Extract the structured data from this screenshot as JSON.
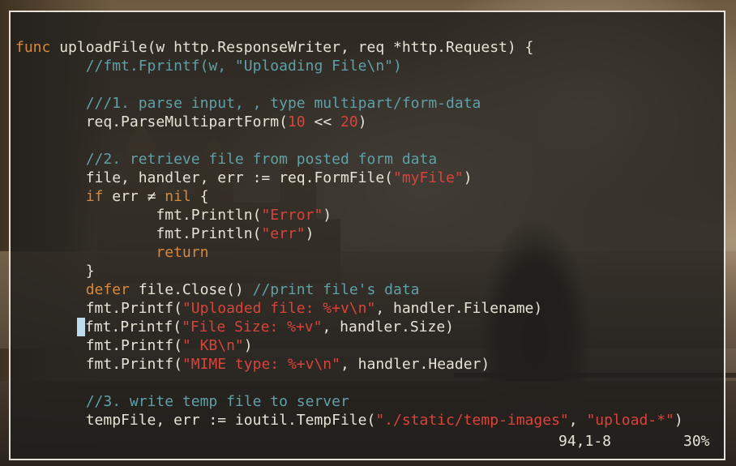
{
  "editor": {
    "lines": [
      [
        {
          "t": "func",
          "c": "kw"
        },
        {
          "t": " uploadFile(w http.ResponseWriter, req *http.Request) {",
          "c": ""
        }
      ],
      [
        {
          "t": "        ",
          "c": ""
        },
        {
          "t": "//fmt.Fprintf(w, \"Uploading File\\n\")",
          "c": "cm"
        }
      ],
      [],
      [
        {
          "t": "        ",
          "c": ""
        },
        {
          "t": "///1. parse input, , type multipart/form-data",
          "c": "cm"
        }
      ],
      [
        {
          "t": "        req.ParseMultipartForm(",
          "c": ""
        },
        {
          "t": "10",
          "c": "nm"
        },
        {
          "t": " << ",
          "c": ""
        },
        {
          "t": "20",
          "c": "nm"
        },
        {
          "t": ")",
          "c": ""
        }
      ],
      [],
      [
        {
          "t": "        ",
          "c": ""
        },
        {
          "t": "//2. retrieve file from posted form data",
          "c": "cm"
        }
      ],
      [
        {
          "t": "        file, handler, err := req.FormFile(",
          "c": ""
        },
        {
          "t": "\"myFile\"",
          "c": "st"
        },
        {
          "t": ")",
          "c": ""
        }
      ],
      [
        {
          "t": "        ",
          "c": ""
        },
        {
          "t": "if",
          "c": "kw"
        },
        {
          "t": " err ≠ ",
          "c": ""
        },
        {
          "t": "nil",
          "c": "kw"
        },
        {
          "t": " {",
          "c": ""
        }
      ],
      [
        {
          "t": "                fmt.Println(",
          "c": ""
        },
        {
          "t": "\"Error\"",
          "c": "st"
        },
        {
          "t": ")",
          "c": ""
        }
      ],
      [
        {
          "t": "                fmt.Println(",
          "c": ""
        },
        {
          "t": "\"err\"",
          "c": "st"
        },
        {
          "t": ")",
          "c": ""
        }
      ],
      [
        {
          "t": "                ",
          "c": ""
        },
        {
          "t": "return",
          "c": "kw"
        }
      ],
      [
        {
          "t": "        }",
          "c": ""
        }
      ],
      [
        {
          "t": "        ",
          "c": ""
        },
        {
          "t": "defer",
          "c": "kw"
        },
        {
          "t": " file.Close() ",
          "c": ""
        },
        {
          "t": "//print file's data",
          "c": "cm"
        }
      ],
      [
        {
          "t": "        fmt.Printf(",
          "c": ""
        },
        {
          "t": "\"Uploaded file: %+v\\n\"",
          "c": "st"
        },
        {
          "t": ", handler.Filename)",
          "c": ""
        }
      ],
      [
        {
          "t": "       ",
          "c": ""
        },
        {
          "t": " ",
          "c": "cursor"
        },
        {
          "t": "fmt.Printf(",
          "c": ""
        },
        {
          "t": "\"File Size: %+v\"",
          "c": "st"
        },
        {
          "t": ", handler.Size)",
          "c": ""
        }
      ],
      [
        {
          "t": "        fmt.Printf(",
          "c": ""
        },
        {
          "t": "\" KB\\n\"",
          "c": "st"
        },
        {
          "t": ")",
          "c": ""
        }
      ],
      [
        {
          "t": "        fmt.Printf(",
          "c": ""
        },
        {
          "t": "\"MIME type: %+v\\n\"",
          "c": "st"
        },
        {
          "t": ", handler.Header)",
          "c": ""
        }
      ],
      [],
      [
        {
          "t": "        ",
          "c": ""
        },
        {
          "t": "//3. write temp file to server",
          "c": "cm"
        }
      ],
      [
        {
          "t": "        tempFile, err := ioutil.TempFile(",
          "c": ""
        },
        {
          "t": "\"./static/temp-images\"",
          "c": "st"
        },
        {
          "t": ", ",
          "c": ""
        },
        {
          "t": "\"upload-*\"",
          "c": "st"
        },
        {
          "t": ")",
          "c": ""
        }
      ]
    ]
  },
  "statusline": {
    "position": "94,1-8",
    "percent": "30%"
  }
}
